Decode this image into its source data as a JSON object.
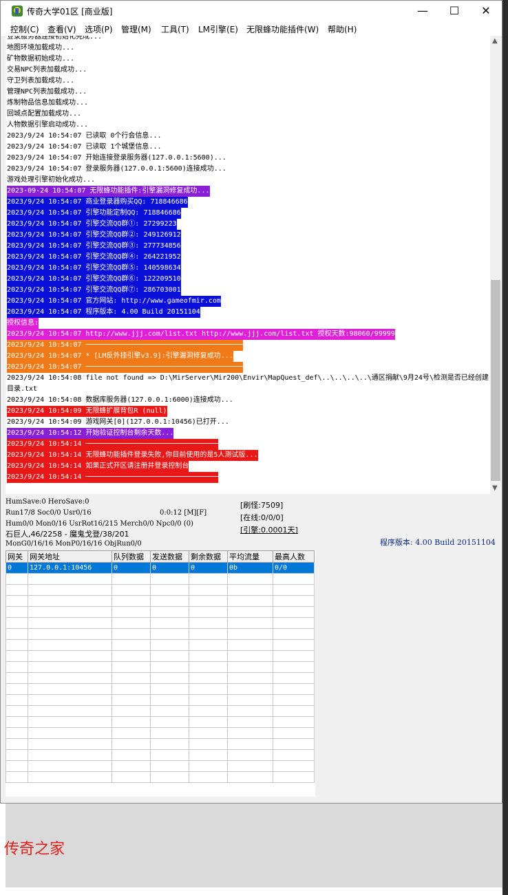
{
  "window": {
    "title": "传奇大学01区 [商业版]",
    "minimize": "—",
    "maximize": "☐",
    "close": "✕"
  },
  "menu": [
    {
      "label": "控制(C)"
    },
    {
      "label": "查看(V)"
    },
    {
      "label": "选项(P)"
    },
    {
      "label": "管理(M)"
    },
    {
      "label": "工具(T)"
    },
    {
      "label": "LM引擎(E)"
    },
    {
      "label": "无限蜂功能插件(W)"
    },
    {
      "label": "帮助(H)"
    }
  ],
  "log": [
    {
      "text": "登录服务器连接初始化完成...",
      "bg": ""
    },
    {
      "text": "地图环境加载成功...",
      "bg": ""
    },
    {
      "text": "矿物数据初始成功...",
      "bg": ""
    },
    {
      "text": "交易NPC列表加载成功...",
      "bg": ""
    },
    {
      "text": "守卫列表加载成功...",
      "bg": ""
    },
    {
      "text": "管理NPC列表加载成功...",
      "bg": ""
    },
    {
      "text": "炼制物品信息加载成功...",
      "bg": ""
    },
    {
      "text": "回城点配置加载成功...",
      "bg": ""
    },
    {
      "text": "人物数据引擎启动成功...",
      "bg": ""
    },
    {
      "text": "2023/9/24 10:54:07 已读取 0个行会信息...",
      "bg": ""
    },
    {
      "text": "2023/9/24 10:54:07 已读取 1个城堡信息...",
      "bg": ""
    },
    {
      "text": "2023/9/24 10:54:07 开始连接登录服务器(127.0.0.1:5600)...",
      "bg": ""
    },
    {
      "text": "2023/9/24 10:54:07 登录服务器(127.0.0.1:5600)连接成功...",
      "bg": ""
    },
    {
      "text": "游戏处理引擎初始化成功...",
      "bg": ""
    },
    {
      "text": "2023-09-24 10:54:07 无限蜂功能插件:引擎漏洞修复成功...",
      "bg": "#8a1fd8"
    },
    {
      "text": "2023/9/24 10:54:07 商业登录器购买QQ: 718846686",
      "bg": "#0a10d8"
    },
    {
      "text": "2023/9/24 10:54:07 引擎功能定制QQ: 718846686",
      "bg": "#0a10d8"
    },
    {
      "text": "2023/9/24 10:54:07 引擎交流QQ群①: 27299223",
      "bg": "#0a10d8"
    },
    {
      "text": "2023/9/24 10:54:07 引擎交流QQ群②: 249126912",
      "bg": "#0a10d8"
    },
    {
      "text": "2023/9/24 10:54:07 引擎交流QQ群③: 277734856",
      "bg": "#0a10d8"
    },
    {
      "text": "2023/9/24 10:54:07 引擎交流QQ群④: 264221952",
      "bg": "#0a10d8"
    },
    {
      "text": "2023/9/24 10:54:07 引擎交流QQ群⑤: 140598634",
      "bg": "#0a10d8"
    },
    {
      "text": "2023/9/24 10:54:07 引擎交流QQ群⑥: 122209510",
      "bg": "#0a10d8"
    },
    {
      "text": "2023/9/24 10:54:07 引擎交流QQ群⑦: 286703001",
      "bg": "#0a10d8"
    },
    {
      "text": "2023/9/24 10:54:07 官方网站: http://www.gameofmir.com",
      "bg": "#0a10d8"
    },
    {
      "text": "2023/9/24 10:54:07 程序版本: 4.00 Build 20151104",
      "bg": "#0a10d8"
    },
    {
      "text": "授权信息:",
      "bg": "#e020d8"
    },
    {
      "text": "2023/9/24 10:54:07 http://www.jjj.com/list.txt http://www.jjj.com/list.txt 授权天数:98060/99999",
      "bg": "#e020d8"
    },
    {
      "text": "2023/9/24 10:54:07 ──────────────────────────────────────",
      "bg": "#f07a18"
    },
    {
      "text": "2023/9/24 10:54:07 * [LM反外挂引擎v3.9]:引擎漏洞修复成功...",
      "bg": "#f07a18"
    },
    {
      "text": "2023/9/24 10:54:07 ──────────────────────────────────────",
      "bg": "#f07a18"
    },
    {
      "text": "2023/9/24 10:54:08 file not found => D:\\MirServer\\Mir200\\Envir\\MapQuest_def\\..\\..\\..\\..\\通区捐献\\9月24号\\检测是否已经创建目录.txt",
      "bg": "",
      "wide": true
    },
    {
      "text": "2023/9/24 10:54:08 数据库服务器(127.0.0.1:6000)连接成功...",
      "bg": ""
    },
    {
      "text": "2023/9/24 10:54:09 无限蜂扩展背包R (null)",
      "bg": "#e81818"
    },
    {
      "text": "2023/9/24 10:54:09 游戏网关[0](127.0.0.1:10456)已打开...",
      "bg": ""
    },
    {
      "text": "2023/9/24 10:54:12 开始验证控制台剩余天数...",
      "bg": "#8a1fd8"
    },
    {
      "text": "2023/9/24 10:54:14 ────────────────────────────────",
      "bg": "#e81818"
    },
    {
      "text": "2023/9/24 10:54:14 无限蜂功能插件登录失败,你目前使用的是5人测试版...",
      "bg": "#e81818"
    },
    {
      "text": "2023/9/24 10:54:14 如果正式开区请注册并登录控制台",
      "bg": "#e81818"
    },
    {
      "text": "2023/9/24 10:54:14 ────────────────────────────────",
      "bg": "#e81818"
    }
  ],
  "status": {
    "line1": "HumSave:0 HeroSave:0",
    "line2": "Run17/8 Soc0/0 Usr0/16",
    "time": "0:0:12 [M][F]",
    "line3": "Hum0/0 Mon0/16 UsrRot16/215 Merch0/0 Npc0/0 (0)",
    "line4": "石巨人,46/2258 - 魔鬼戈登/38/201",
    "line5": "MonG0/16/16 MonP0/16/16 ObjRun0/0",
    "refresh": "[刷怪:7509]",
    "online": "[在线:0/0/0]",
    "engine": "[引擎:0.0001天]",
    "version": "程序版本: 4.00 Build 20151104"
  },
  "grid": {
    "headers": [
      "网关",
      "网关地址",
      "队列数据",
      "发送数据",
      "剩余数据",
      "平均流量",
      "最高人数"
    ],
    "rows": [
      [
        "0",
        "127.0.0.1:10456",
        "0",
        "0",
        "0",
        "0b",
        "0/0"
      ]
    ]
  },
  "watermark": "传奇之家"
}
